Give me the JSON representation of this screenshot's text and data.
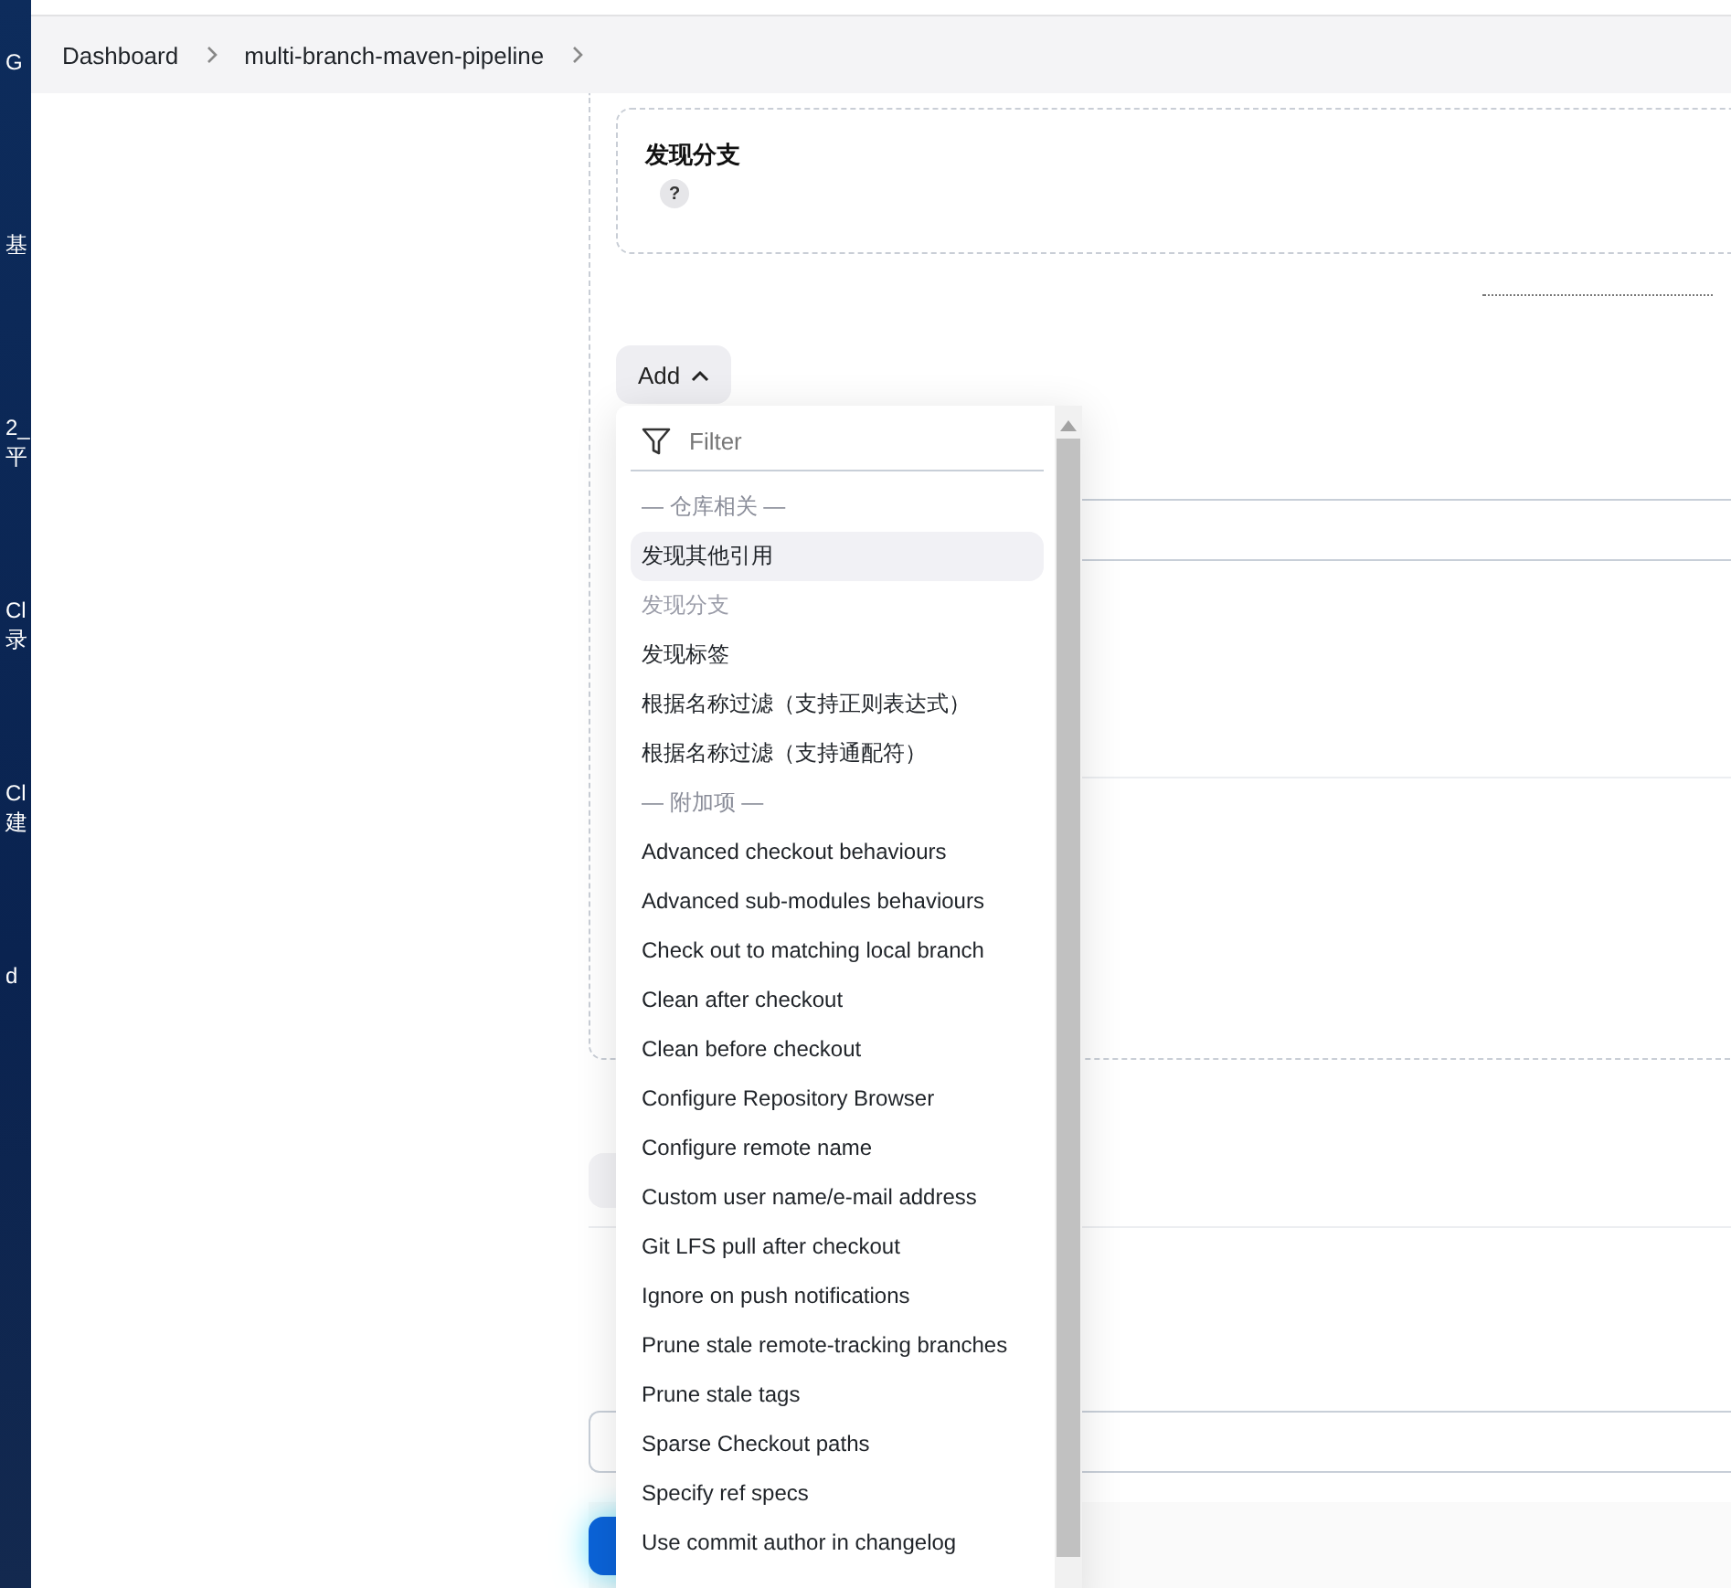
{
  "desktop": {
    "icons": [
      {
        "lines": [
          "G"
        ]
      },
      {
        "lines": [
          "基"
        ]
      },
      {
        "lines": [
          "2_",
          "平"
        ]
      },
      {
        "lines": [
          "Cl",
          "录"
        ]
      },
      {
        "lines": [
          "Cl",
          "建"
        ]
      },
      {
        "lines": [
          "d"
        ]
      }
    ]
  },
  "breadcrumb": [
    "Dashboard",
    "multi-branch-maven-pipeline"
  ],
  "trait_card": {
    "title": "发现分支",
    "help": "?"
  },
  "add_button": {
    "label": "Add",
    "expanded": true
  },
  "menu": {
    "filter_placeholder": "Filter",
    "items": [
      {
        "kind": "header",
        "label": "— 仓库相关 —"
      },
      {
        "kind": "item",
        "label": "发现其他引用",
        "selected": true,
        "disabled": false
      },
      {
        "kind": "item",
        "label": "发现分支",
        "selected": false,
        "disabled": true
      },
      {
        "kind": "item",
        "label": "发现标签",
        "selected": false,
        "disabled": false
      },
      {
        "kind": "item",
        "label": "根据名称过滤（支持正则表达式）",
        "selected": false,
        "disabled": false
      },
      {
        "kind": "item",
        "label": "根据名称过滤（支持通配符）",
        "selected": false,
        "disabled": false
      },
      {
        "kind": "header",
        "label": "— 附加项 —"
      },
      {
        "kind": "item",
        "label": "Advanced checkout behaviours",
        "selected": false,
        "disabled": false
      },
      {
        "kind": "item",
        "label": "Advanced sub-modules behaviours",
        "selected": false,
        "disabled": false
      },
      {
        "kind": "item",
        "label": "Check out to matching local branch",
        "selected": false,
        "disabled": false
      },
      {
        "kind": "item",
        "label": "Clean after checkout",
        "selected": false,
        "disabled": false
      },
      {
        "kind": "item",
        "label": "Clean before checkout",
        "selected": false,
        "disabled": false
      },
      {
        "kind": "item",
        "label": "Configure Repository Browser",
        "selected": false,
        "disabled": false
      },
      {
        "kind": "item",
        "label": "Configure remote name",
        "selected": false,
        "disabled": false
      },
      {
        "kind": "item",
        "label": "Custom user name/e-mail address",
        "selected": false,
        "disabled": false
      },
      {
        "kind": "item",
        "label": "Git LFS pull after checkout",
        "selected": false,
        "disabled": false
      },
      {
        "kind": "item",
        "label": "Ignore on push notifications",
        "selected": false,
        "disabled": false
      },
      {
        "kind": "item",
        "label": "Prune stale remote-tracking branches",
        "selected": false,
        "disabled": false
      },
      {
        "kind": "item",
        "label": "Prune stale tags",
        "selected": false,
        "disabled": false
      },
      {
        "kind": "item",
        "label": "Sparse Checkout paths",
        "selected": false,
        "disabled": false
      },
      {
        "kind": "item",
        "label": "Specify ref specs",
        "selected": false,
        "disabled": false
      },
      {
        "kind": "item",
        "label": "Use commit author in changelog",
        "selected": false,
        "disabled": false
      }
    ]
  }
}
